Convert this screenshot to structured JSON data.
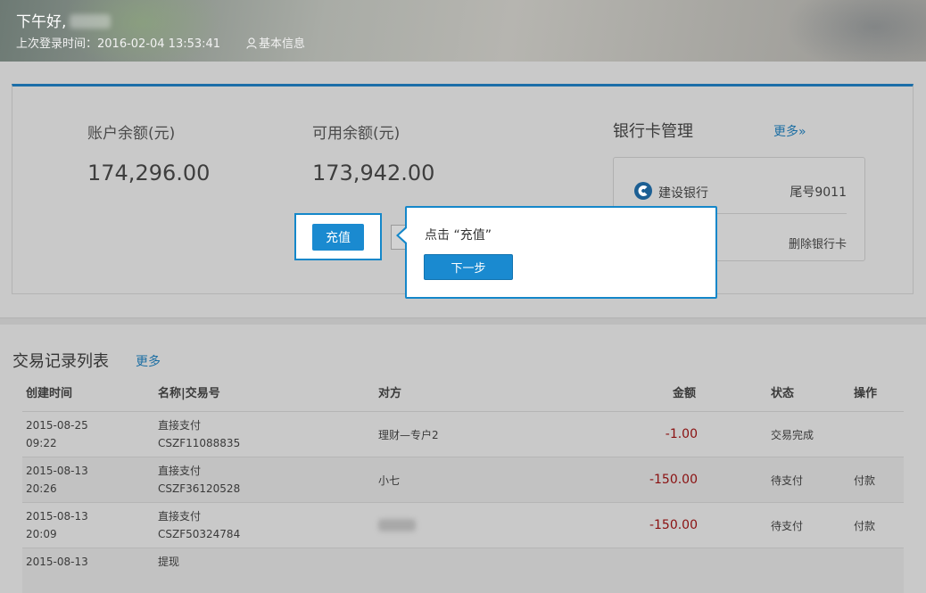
{
  "header": {
    "greeting": "下午好,",
    "last_login": "上次登录时间：2016-02-04 13:53:41",
    "basic_info": "基本信息"
  },
  "account": {
    "balance_label": "账户余额(元)",
    "balance_value": "174,296.00",
    "available_label": "可用余额(元)",
    "available_value": "173,942.00",
    "recharge_label": "充值"
  },
  "bank": {
    "title": "银行卡管理",
    "more_label": "更多»",
    "card_bank_name": "建设银行",
    "card_tail": "尾号9011",
    "delete_label": "删除银行卡"
  },
  "tooltip": {
    "text": "点击 “充值”",
    "next_label": "下一步"
  },
  "transactions": {
    "title": "交易记录列表",
    "more_label": "更多",
    "columns": [
      "创建时间",
      "名称|交易号",
      "对方",
      "金额",
      "状态",
      "操作"
    ],
    "rows": [
      {
        "date": "2015-08-25",
        "time": "09:22",
        "name": "直接支付",
        "txid": "CSZF11088835",
        "party": "理财—专户2",
        "amount": "-1.00",
        "status": "交易完成",
        "action": ""
      },
      {
        "date": "2015-08-13",
        "time": "20:26",
        "name": "直接支付",
        "txid": "CSZF36120528",
        "party": "小七",
        "amount": "-150.00",
        "status": "待支付",
        "action": "付款"
      },
      {
        "date": "2015-08-13",
        "time": "20:09",
        "name": "直接支付",
        "txid": "CSZF50324784",
        "party": "",
        "amount": "-150.00",
        "status": "待支付",
        "action": "付款"
      },
      {
        "date": "2015-08-13",
        "time": "",
        "name": "提现",
        "txid": "",
        "party": "",
        "amount": "",
        "status": "",
        "action": ""
      }
    ]
  },
  "colors": {
    "accent": "#1a8ad0",
    "panel_top_border": "#1b6ea8",
    "link": "#1c6ea3",
    "negative_amount": "#8a1010"
  },
  "icons": {
    "user": "user-icon",
    "bank_logo": "ccb-logo-icon",
    "more_arrow": "double-chevron-right-icon"
  }
}
